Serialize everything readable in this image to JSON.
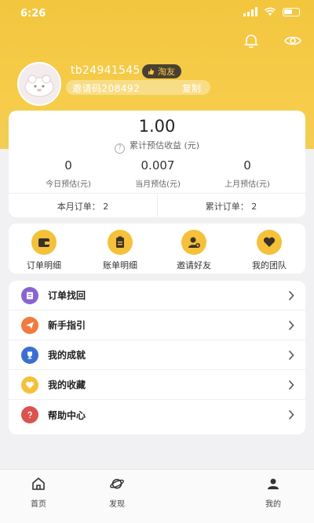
{
  "status_bar": {
    "time": "6:26"
  },
  "profile": {
    "username": "tb24941545",
    "badge": "淘友",
    "invite_code": "邀请码208492",
    "copy_label": "复制"
  },
  "earnings": {
    "total_value": "1.00",
    "total_label": "累计预估收益 (元)",
    "stats": [
      {
        "value": "0",
        "label": "今日预估(元)"
      },
      {
        "value": "0.007",
        "label": "当月预估(元)"
      },
      {
        "value": "0",
        "label": "上月预估(元)"
      }
    ],
    "orders": [
      {
        "label": "本月订单： 2"
      },
      {
        "label": "累计订单： 2"
      }
    ]
  },
  "tools": [
    {
      "label": "订单明细",
      "icon": "wallet-icon"
    },
    {
      "label": "账单明细",
      "icon": "clipboard-icon"
    },
    {
      "label": "邀请好友",
      "icon": "add-friend-icon"
    },
    {
      "label": "我的团队",
      "icon": "heart-icon"
    }
  ],
  "menu": [
    {
      "label": "订单找回",
      "icon": "order-recover-icon",
      "color": "#8a63d2"
    },
    {
      "label": "新手指引",
      "icon": "paper-plane-icon",
      "color": "#f07b3f"
    },
    {
      "label": "我的成就",
      "icon": "trophy-icon",
      "color": "#3a6fd1"
    },
    {
      "label": "我的收藏",
      "icon": "heart-icon",
      "color": "#f5c13a"
    },
    {
      "label": "帮助中心",
      "icon": "help-icon",
      "color": "#d9534f"
    }
  ],
  "tabbar": [
    {
      "label": "首页",
      "icon": "home-icon"
    },
    {
      "label": "发现",
      "icon": "planet-icon"
    },
    {
      "label": "我的",
      "icon": "user-icon"
    }
  ],
  "colors": {
    "header": "#f3c63e",
    "accent": "#f5c13a"
  }
}
